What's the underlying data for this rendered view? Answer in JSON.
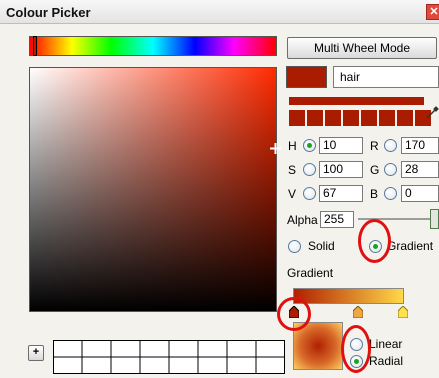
{
  "window": {
    "title": "Colour Picker",
    "close_icon": "close-icon"
  },
  "mode_button": {
    "label": "Multi Wheel Mode"
  },
  "name_field": {
    "value": "hair"
  },
  "hsv": {
    "h": {
      "label": "H",
      "value": "10",
      "selected": true
    },
    "s": {
      "label": "S",
      "value": "100",
      "selected": false
    },
    "v": {
      "label": "V",
      "value": "67",
      "selected": false
    }
  },
  "rgb": {
    "r": {
      "label": "R",
      "value": "170",
      "selected": false
    },
    "g": {
      "label": "G",
      "value": "28",
      "selected": false
    },
    "b": {
      "label": "B",
      "value": "0",
      "selected": false
    }
  },
  "alpha": {
    "label": "Alpha",
    "value": "255"
  },
  "fill_type": {
    "solid": "Solid",
    "gradient": "Gradient",
    "selected": "Gradient"
  },
  "gradient_section": {
    "label": "Gradient",
    "start_color": "#b02000",
    "end_color": "#ffd84a",
    "stops": [
      {
        "color": "#aa1c00",
        "selected": true
      },
      {
        "color": "#f2a640",
        "selected": false
      },
      {
        "color": "#ffe24a",
        "selected": false
      }
    ]
  },
  "gradient_type": {
    "linear": "Linear",
    "radial": "Radial",
    "selected": "Radial"
  },
  "current_color": "#aa1c00",
  "palette": [
    "#aa1c00",
    "#aa1c00",
    "#aa1c00",
    "#aa1c00",
    "#aa1c00",
    "#aa1c00",
    "#aa1c00",
    "#aa1c00"
  ],
  "add_button": {
    "label": "+"
  }
}
